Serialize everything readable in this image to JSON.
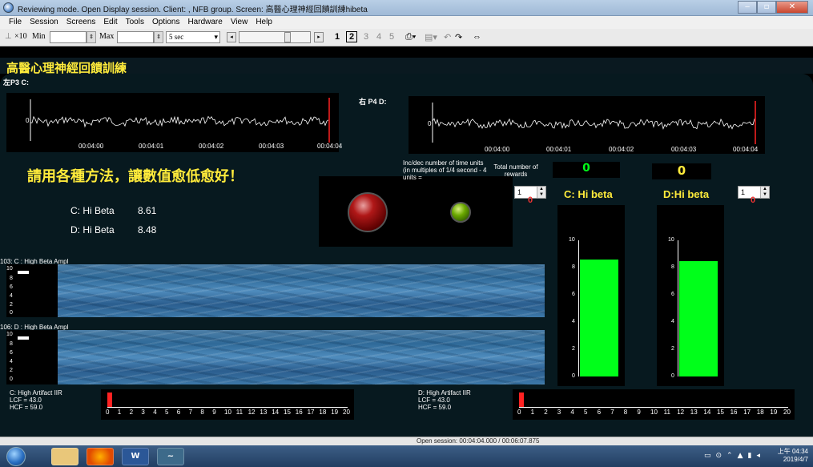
{
  "window": {
    "title": "Reviewing mode. Open Display session. Client: , NFB group. Screen: 高醫心理神經回饋訓練hibeta"
  },
  "menu": [
    "File",
    "Session",
    "Screens",
    "Edit",
    "Tools",
    "Options",
    "Hardware",
    "View",
    "Help"
  ],
  "toolbar": {
    "zoom_label": "×10",
    "min_label": "Min",
    "max_label": "Max",
    "time_select": "5 sec",
    "pages": [
      "1",
      "2",
      "3",
      "4",
      "5"
    ],
    "current_page": "2"
  },
  "app": {
    "title": "高醫心理神經回饋訓練",
    "left_channel_label": "左P3 C:",
    "right_channel_label": "右 P4 D:",
    "time_ticks": [
      "00:04:00",
      "00:04:01",
      "00:04:02",
      "00:04:03",
      "00:04:04"
    ],
    "instruction": "請用各種方法，讓數值愈低愈好！",
    "readout": {
      "c_label": "C: Hi Beta",
      "c_value": "8.61",
      "d_label": "D: Hi Beta",
      "d_value": "8.48"
    },
    "incdec_text": "Inc/dec number of time units (in multiples of 1/4 second - 4 units =",
    "rewards_label": "Total number of rewards",
    "reward_left": "0",
    "reward_right": "0",
    "spin_left": "1",
    "spin_right": "1",
    "spin_left_counter": "0",
    "spin_right_counter": "0",
    "bar_left_title": "C: Hi beta",
    "bar_right_title": "D:Hi beta",
    "bar_y_ticks": [
      "10",
      "8",
      "6",
      "4",
      "2",
      "0"
    ],
    "bar_left_value": 8.61,
    "bar_right_value": 8.48,
    "ampl_top_label": "103: C : High Beta Ampl",
    "ampl_bottom_label": "106: D : High Beta Ampl",
    "ampl_y_ticks": [
      "10",
      "8",
      "6",
      "4",
      "2",
      "0"
    ],
    "artifact_left": [
      "C: High Artifact IIR",
      "LCF = 43.0",
      "HCF = 59.0"
    ],
    "artifact_right": [
      "D: High Artifact IIR",
      "LCF = 43.0",
      "HCF = 59.0"
    ],
    "artifact_scale": [
      "0",
      "1",
      "2",
      "3",
      "4",
      "5",
      "6",
      "7",
      "8",
      "9",
      "10",
      "11",
      "12",
      "13",
      "14",
      "15",
      "16",
      "17",
      "18",
      "19",
      "20"
    ]
  },
  "status": {
    "text": "Open session: 00:04:04.000 / 00:06:07.875"
  },
  "taskbar": {
    "clock_time": "上午 04:34",
    "clock_date": "2019/4/7"
  },
  "colors": {
    "title_yellow": "#ffeb3b",
    "bar_green": "#00ff1a",
    "panel_bg": "#07191f"
  }
}
